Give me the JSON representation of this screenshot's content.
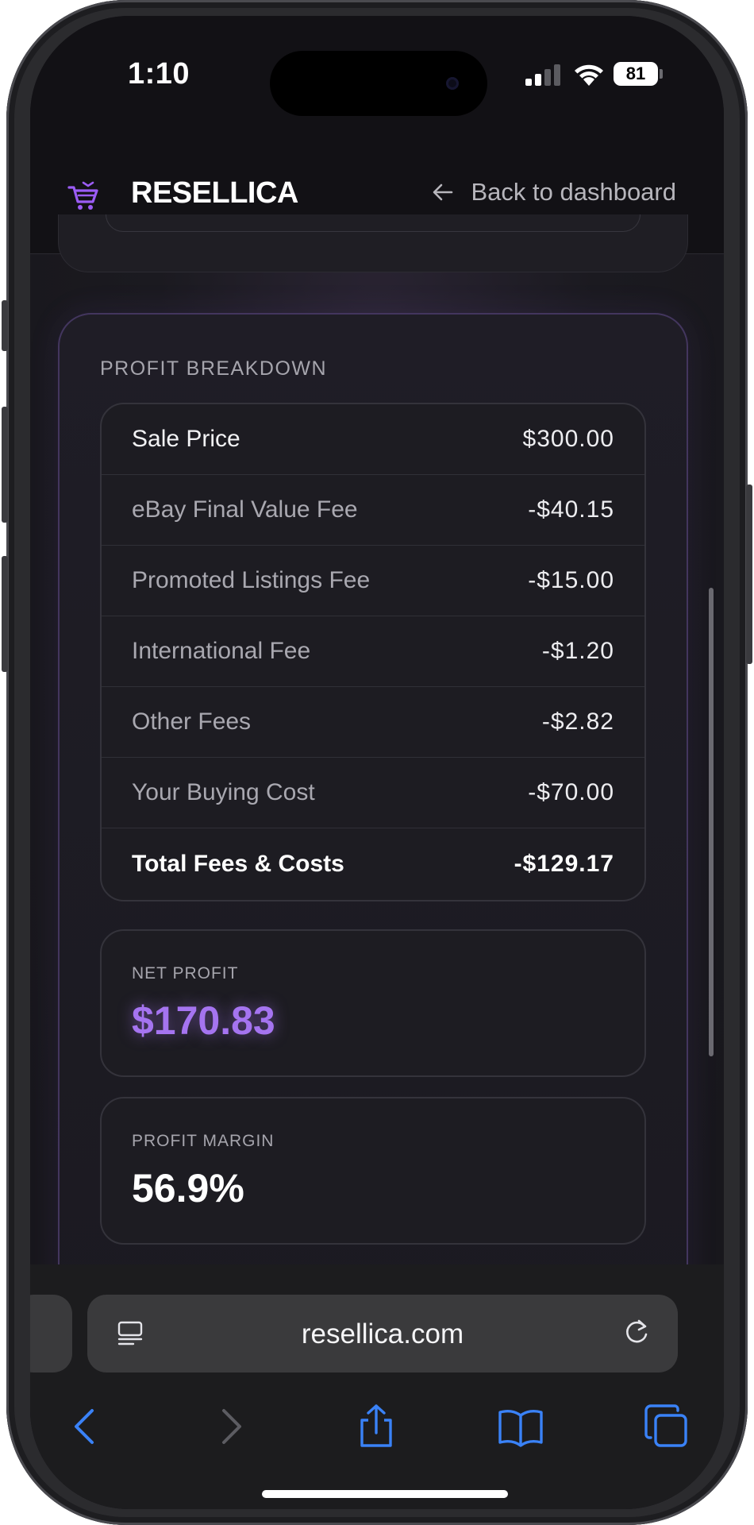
{
  "status_bar": {
    "time": "1:10",
    "battery": "81"
  },
  "header": {
    "brand": "RESELLICA",
    "logo_icon": "cart-icon",
    "back_label": "Back to dashboard",
    "back_icon": "arrow-left-icon"
  },
  "breakdown": {
    "title": "PROFIT BREAKDOWN",
    "rows": [
      {
        "label": "Sale Price",
        "value": "$300.00"
      },
      {
        "label": "eBay Final Value Fee",
        "value": "-$40.15"
      },
      {
        "label": "Promoted Listings Fee",
        "value": "-$15.00"
      },
      {
        "label": "International Fee",
        "value": "-$1.20"
      },
      {
        "label": "Other Fees",
        "value": "-$2.82"
      },
      {
        "label": "Your Buying Cost",
        "value": "-$70.00"
      },
      {
        "label": "Total Fees & Costs",
        "value": "-$129.17"
      }
    ]
  },
  "net_profit": {
    "label": "NET PROFIT",
    "value": "$170.83"
  },
  "profit_margin": {
    "label": "PROFIT MARGIN",
    "value": "56.9%"
  },
  "browser": {
    "url": "resellica.com"
  },
  "colors": {
    "accent_purple": "#a574f0",
    "ios_blue": "#3a82f7",
    "background": "#18171c"
  }
}
